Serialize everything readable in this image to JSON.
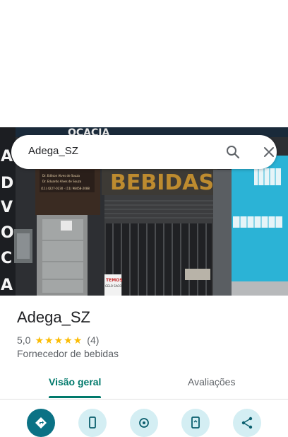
{
  "search": {
    "query": "Adega_SZ"
  },
  "photo": {
    "sign_top": "OCACIA",
    "sign_bebidas": "BEBIDAS",
    "sign_side": [
      "A",
      "D",
      "V",
      "O",
      "C",
      "A"
    ],
    "plaque_line1": "Dr. Edilson Alves de Souza",
    "plaque_line2": "Dr. Eduardo Alves de Souza",
    "plaque_phone": "(11) 4227-0230 · (11) 98458-2088",
    "small_sign_line1": "TEMOS",
    "small_sign_line2": "GELO SACO"
  },
  "place": {
    "name": "Adega_SZ",
    "rating_value": "5,0",
    "stars": 5,
    "review_count": "(4)",
    "category": "Fornecedor de bebidas"
  },
  "tabs": [
    {
      "label": "Visão geral",
      "active": true
    },
    {
      "label": "Avaliações",
      "active": false
    }
  ],
  "actions": [
    {
      "icon": "directions-icon",
      "primary": true
    },
    {
      "icon": "phone-icon",
      "primary": false
    },
    {
      "icon": "save-icon",
      "primary": false
    },
    {
      "icon": "send-to-phone-icon",
      "primary": false
    },
    {
      "icon": "share-icon",
      "primary": false
    }
  ],
  "colors": {
    "accent": "#00796b",
    "star": "#fbbc04",
    "action_bg": "#d4eef3",
    "action_primary": "#0b7285"
  }
}
